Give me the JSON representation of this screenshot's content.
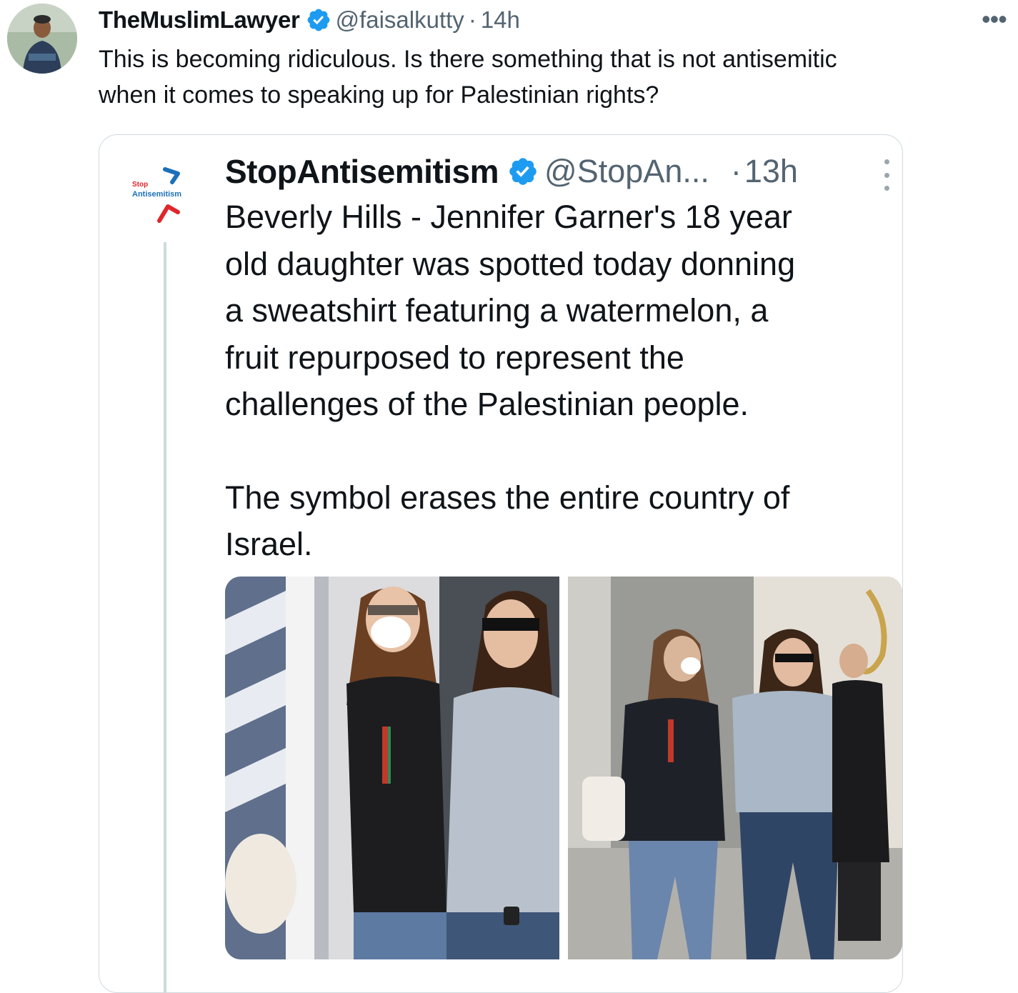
{
  "tweet": {
    "author": {
      "display_name": "TheMuslimLawyer",
      "handle": "@faisalkutty",
      "verified": true
    },
    "separator": "·",
    "timestamp": "14h",
    "more_icon": "more-horizontal-icon",
    "text_lines": [
      "This is becoming ridiculous.  Is there something that is not antisemitic",
      "when it comes to speaking up for Palestinian rights?"
    ]
  },
  "quoted_tweet": {
    "author": {
      "display_name": "StopAntisemitism",
      "handle": "@StopAn...",
      "verified": true
    },
    "logo_text": [
      "Stop",
      "Antisemitism"
    ],
    "separator": "·",
    "timestamp": "13h",
    "more_icon": "more-vertical-icon",
    "text_lines": [
      "Beverly Hills - Jennifer Garner's 18 year",
      "old daughter was spotted today donning",
      "a sweatshirt featuring a watermelon, a",
      "fruit repurposed to represent the",
      "challenges of the Palestinian people.",
      "",
      "The symbol erases the entire country of",
      "Israel."
    ],
    "images": [
      {
        "description_icon": "photo-street-left"
      },
      {
        "description_icon": "photo-street-right"
      }
    ]
  },
  "colors": {
    "verified_blue": "#1d9bf0",
    "secondary_text": "#536471",
    "border": "#cfd9de",
    "logo_red": "#e0252b",
    "logo_blue": "#1d70b8"
  }
}
